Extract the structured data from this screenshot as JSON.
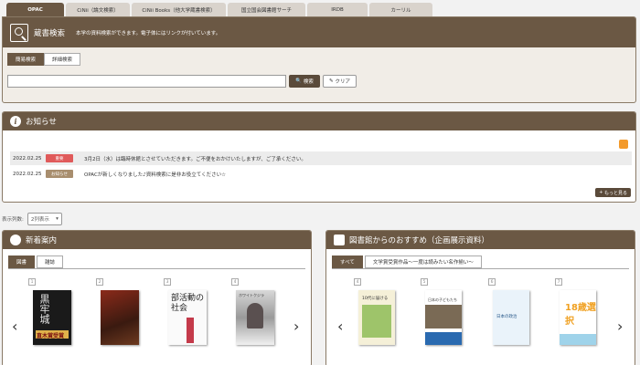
{
  "tabs": [
    "OPAC",
    "CiNii（論文検索）",
    "CiNii Books（他大学蔵書検索）",
    "国立国会図書館サーチ",
    "IRDB",
    "カーリル"
  ],
  "search": {
    "title": "蔵書検索",
    "description": "本学の資料検索ができます。電子体にはリンクが付いています。",
    "subtabs": [
      "簡易検索",
      "詳細検索"
    ],
    "input_value": "",
    "search_button": "検索",
    "clear_button": "クリア"
  },
  "news": {
    "title": "お知らせ",
    "items": [
      {
        "date": "2022.02.25",
        "badge": "重要",
        "text": "3月2日（水）は臨時休館とさせていただきます。ご不便をおかけいたしますが、ご了承ください。"
      },
      {
        "date": "2022.02.25",
        "badge": "お知らせ",
        "text": "OPACが新しくなりました♪資料検索に是非お役立てください☆"
      }
    ],
    "more": "もっと見る"
  },
  "display": {
    "label": "表示列数:",
    "value": "2列表示"
  },
  "new_arrivals": {
    "title": "新着案内",
    "tabs": [
      "図書",
      "雑誌"
    ],
    "book_numbers": [
      "1",
      "2",
      "3",
      "4"
    ],
    "covers": [
      "黒牢城",
      "",
      "部活動の社会",
      "ホワイトクジラ"
    ],
    "award": "直木賞受賞"
  },
  "recommend": {
    "title": "図書館からのおすすめ（企画展示資料）",
    "tabs": [
      "すべて",
      "文学賞受賞作品～一度は読みたい名作揃い～"
    ],
    "book_numbers": [
      "4",
      "5",
      "6",
      "7"
    ],
    "covers": [
      "10代に届ける",
      "日本の子どもたち",
      "日本の政治",
      "18歳選択"
    ]
  },
  "colors": {
    "brand": "#6b5844",
    "accent_red": "#e05a5a"
  }
}
